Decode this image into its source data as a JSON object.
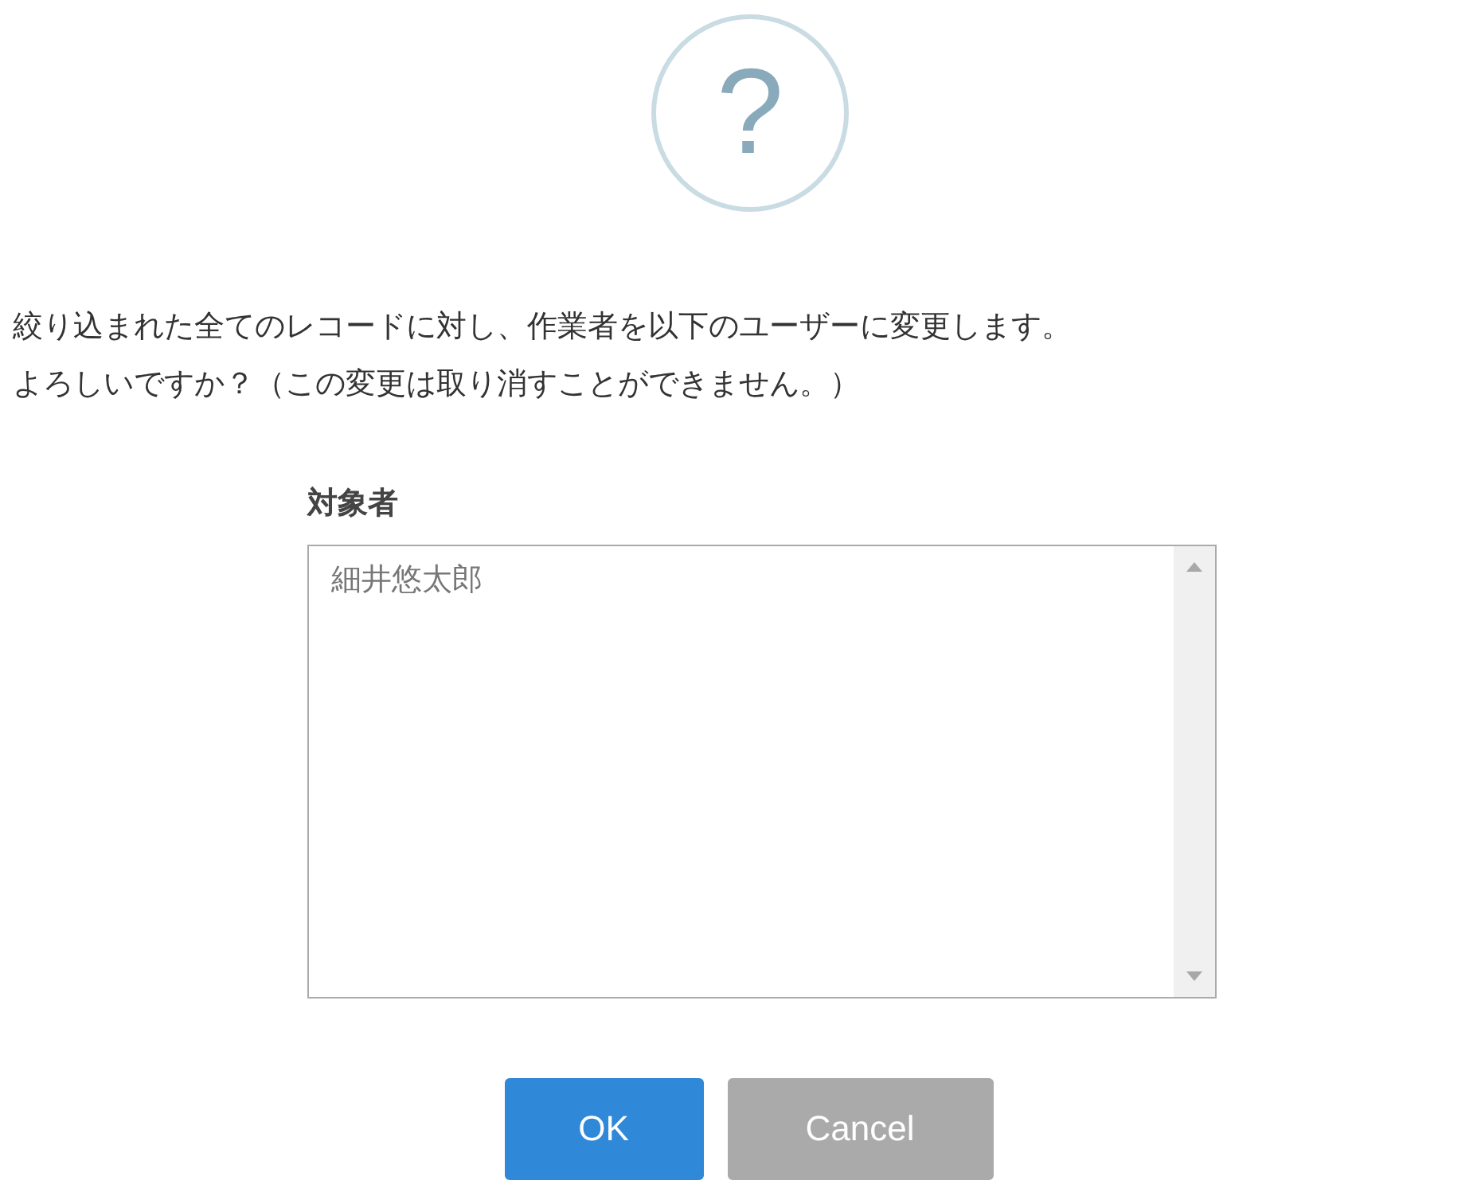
{
  "icon": {
    "symbol": "?"
  },
  "message": [
    "絞り込まれた全てのレコードに対し、作業者を以下のユーザーに変更します。",
    "よろしいですか？（この変更は取り消すことができません。）"
  ],
  "field": {
    "label": "対象者",
    "items": [
      {
        "text": "細井悠太郎"
      }
    ]
  },
  "buttons": [
    {
      "label": "OK",
      "kind": "primary"
    },
    {
      "label": "Cancel",
      "kind": "secondary"
    }
  ]
}
